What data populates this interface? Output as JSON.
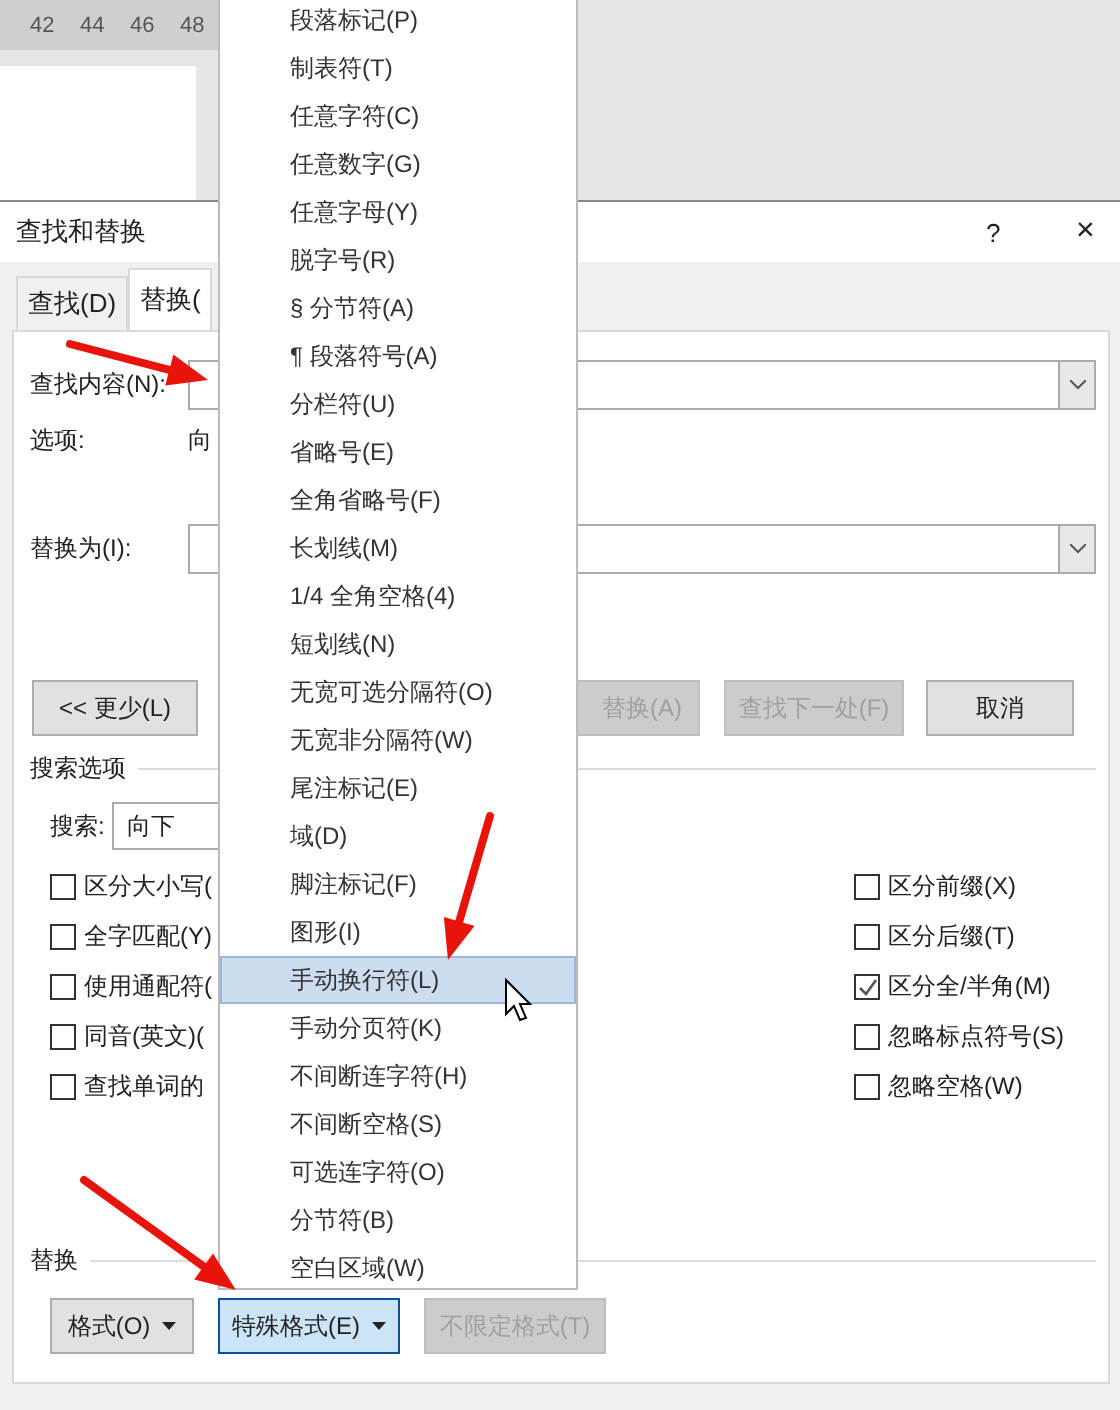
{
  "ruler": {
    "numbers": [
      "42",
      "44",
      "46",
      "48"
    ]
  },
  "dialog": {
    "title": "查找和替换",
    "help": "?",
    "close": "×"
  },
  "tabs": [
    {
      "label": "查找(D)",
      "selected": false
    },
    {
      "label": "替换(",
      "selected": true
    }
  ],
  "find": {
    "label": "查找内容(N):"
  },
  "options": {
    "label": "选项:",
    "value": "向"
  },
  "replace_with": {
    "label": "替换为(I):"
  },
  "buttons": [
    {
      "label": "<< 更少(L)",
      "disabled": false
    },
    {
      "label": "替换(A)",
      "disabled": true
    },
    {
      "label": "查找下一处(F)",
      "disabled": true
    },
    {
      "label": "取消",
      "disabled": false
    }
  ],
  "search_options": {
    "title": "搜索选项",
    "search_label": "搜索:",
    "search_value": "向下"
  },
  "checkboxes_left": [
    {
      "label": "区分大小写(",
      "checked": false
    },
    {
      "label": "全字匹配(Y)",
      "checked": false
    },
    {
      "label": "使用通配符(",
      "checked": false
    },
    {
      "label": "同音(英文)(",
      "checked": false
    },
    {
      "label": "查找单词的",
      "checked": false
    }
  ],
  "checkboxes_right": [
    {
      "label": "区分前缀(X)",
      "checked": false
    },
    {
      "label": "区分后缀(T)",
      "checked": false
    },
    {
      "label": "区分全/半角(M)",
      "checked": true
    },
    {
      "label": "忽略标点符号(S)",
      "checked": false
    },
    {
      "label": "忽略空格(W)",
      "checked": false
    }
  ],
  "replace_section": {
    "title": "替换",
    "buttons": [
      {
        "label": "格式(O)",
        "pressed": false,
        "disabled": false,
        "dropdown": true
      },
      {
        "label": "特殊格式(E)",
        "pressed": true,
        "disabled": false,
        "dropdown": true
      },
      {
        "label": "不限定格式(T)",
        "pressed": false,
        "disabled": true,
        "dropdown": false
      }
    ]
  },
  "menu": {
    "items": [
      {
        "label": "段落标记(P)",
        "selected": false
      },
      {
        "label": "制表符(T)",
        "selected": false
      },
      {
        "label": "任意字符(C)",
        "selected": false
      },
      {
        "label": "任意数字(G)",
        "selected": false
      },
      {
        "label": "任意字母(Y)",
        "selected": false
      },
      {
        "label": "脱字号(R)",
        "selected": false
      },
      {
        "label": "§ 分节符(A)",
        "selected": false
      },
      {
        "label": "¶ 段落符号(A)",
        "selected": false
      },
      {
        "label": "分栏符(U)",
        "selected": false
      },
      {
        "label": "省略号(E)",
        "selected": false
      },
      {
        "label": "全角省略号(F)",
        "selected": false
      },
      {
        "label": "长划线(M)",
        "selected": false
      },
      {
        "label": "1/4 全角空格(4)",
        "selected": false
      },
      {
        "label": "短划线(N)",
        "selected": false
      },
      {
        "label": "无宽可选分隔符(O)",
        "selected": false
      },
      {
        "label": "无宽非分隔符(W)",
        "selected": false
      },
      {
        "label": "尾注标记(E)",
        "selected": false
      },
      {
        "label": "域(D)",
        "selected": false
      },
      {
        "label": "脚注标记(F)",
        "selected": false
      },
      {
        "label": "图形(I)",
        "selected": false
      },
      {
        "label": "手动换行符(L)",
        "selected": true
      },
      {
        "label": "手动分页符(K)",
        "selected": false
      },
      {
        "label": "不间断连字符(H)",
        "selected": false
      },
      {
        "label": "不间断空格(S)",
        "selected": false
      },
      {
        "label": "可选连字符(O)",
        "selected": false
      },
      {
        "label": "分节符(B)",
        "selected": false
      },
      {
        "label": "空白区域(W)",
        "selected": false
      }
    ]
  }
}
